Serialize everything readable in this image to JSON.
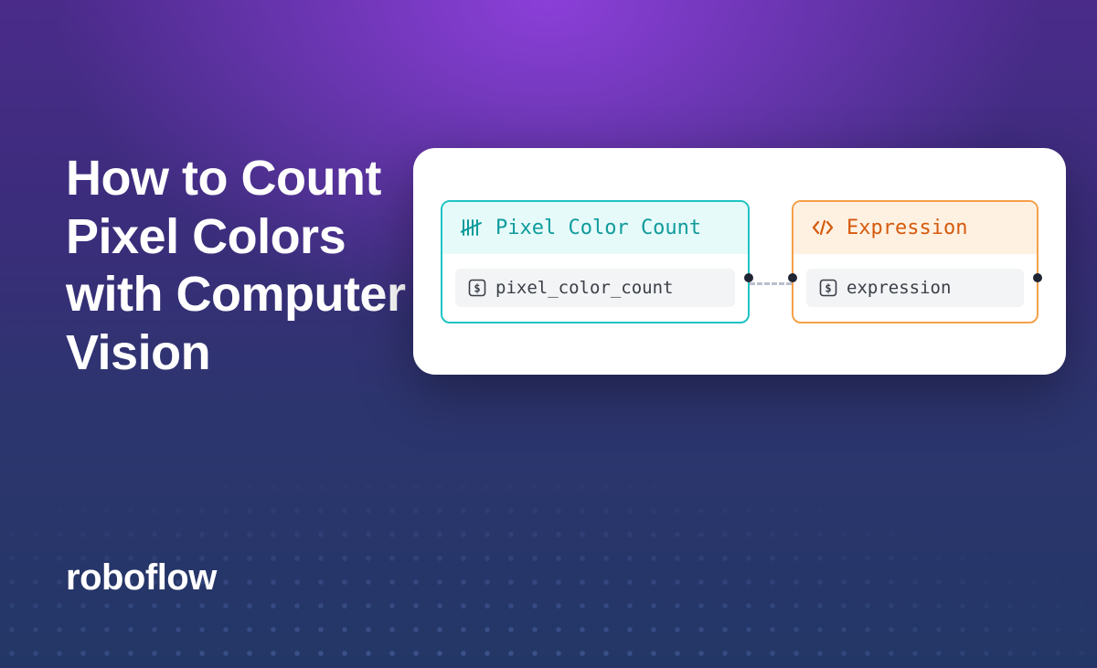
{
  "title_lines": [
    "How to Count",
    "Pixel Colors",
    "with Computer",
    "Vision"
  ],
  "brand": "roboflow",
  "diagram": {
    "node1": {
      "header": "Pixel Color Count",
      "output": "pixel_color_count"
    },
    "node2": {
      "header": "Expression",
      "output": "expression"
    }
  }
}
